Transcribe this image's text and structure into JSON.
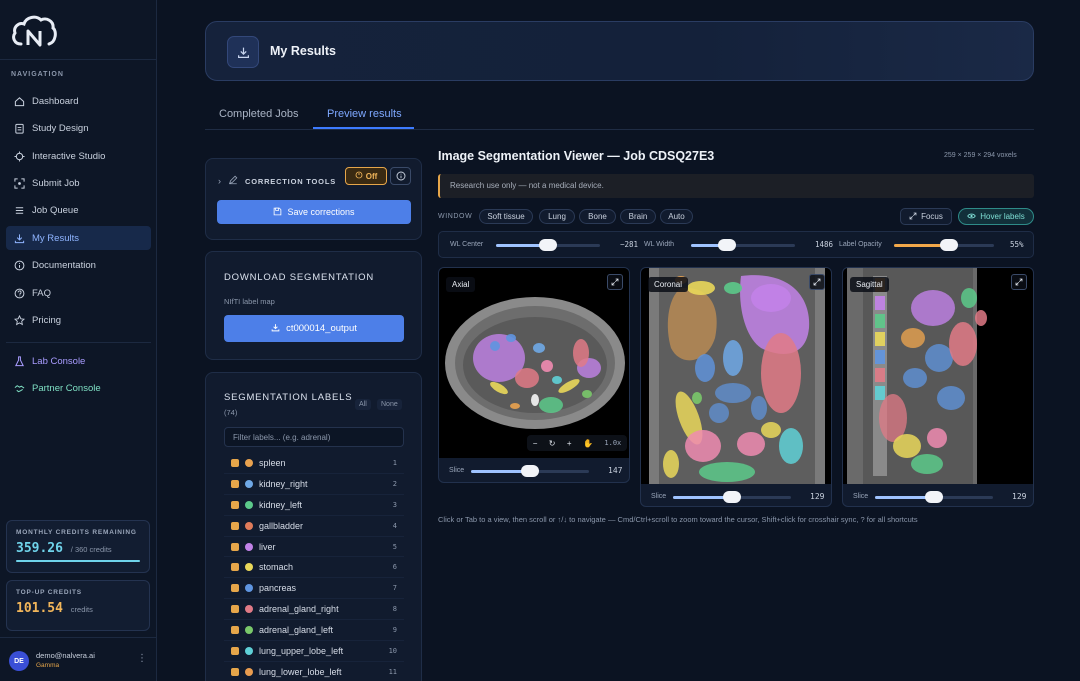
{
  "sidebar": {
    "nav_heading": "NAVIGATION",
    "items": [
      {
        "label": "Dashboard",
        "icon": "home-icon"
      },
      {
        "label": "Study Design",
        "icon": "clipboard-icon"
      },
      {
        "label": "Interactive Studio",
        "icon": "crosshair-icon"
      },
      {
        "label": "Submit Job",
        "icon": "scan-icon"
      },
      {
        "label": "Job Queue",
        "icon": "list-icon"
      },
      {
        "label": "My Results",
        "icon": "download-icon",
        "active": true
      },
      {
        "label": "Documentation",
        "icon": "info-circle-icon"
      },
      {
        "label": "FAQ",
        "icon": "question-icon"
      },
      {
        "label": "Pricing",
        "icon": "star-icon"
      }
    ],
    "consoles": [
      {
        "label": "Lab Console",
        "icon": "flask-icon"
      },
      {
        "label": "Partner Console",
        "icon": "handshake-icon"
      }
    ],
    "credits": {
      "monthly_title": "MONTHLY CREDITS REMAINING",
      "monthly_value": "359.26",
      "monthly_suffix": "/ 360 credits",
      "monthly_fraction": 0.998,
      "topup_title": "TOP-UP CREDITS",
      "topup_value": "101.54",
      "topup_suffix": "credits"
    },
    "user": {
      "initials": "DE",
      "email": "demo@nalvera.ai",
      "plan": "Gamma"
    }
  },
  "header": {
    "title": "My Results"
  },
  "tabs": [
    {
      "label": "Completed Jobs",
      "active": false
    },
    {
      "label": "Preview results",
      "active": true
    }
  ],
  "correction": {
    "label": "CORRECTION TOOLS",
    "toggle": "Off",
    "save": "Save corrections"
  },
  "download": {
    "title": "DOWNLOAD SEGMENTATION",
    "subtitle": "NIfTI label map",
    "button": "ct000014_output"
  },
  "labels_panel": {
    "title": "SEGMENTATION LABELS",
    "count": "(74)",
    "all": "All",
    "none": "None",
    "filter_placeholder": "Filter labels... (e.g. adrenal)",
    "items": [
      {
        "name": "spleen",
        "num": "1",
        "color": "#e9a24f"
      },
      {
        "name": "kidney_right",
        "num": "2",
        "color": "#6fa8e6"
      },
      {
        "name": "kidney_left",
        "num": "3",
        "color": "#5cc98a"
      },
      {
        "name": "gallbladder",
        "num": "4",
        "color": "#e07b5a"
      },
      {
        "name": "liver",
        "num": "5",
        "color": "#c282e8"
      },
      {
        "name": "stomach",
        "num": "6",
        "color": "#e9d75a"
      },
      {
        "name": "pancreas",
        "num": "7",
        "color": "#5f95e0"
      },
      {
        "name": "adrenal_gland_right",
        "num": "8",
        "color": "#e07a86"
      },
      {
        "name": "adrenal_gland_left",
        "num": "9",
        "color": "#7ac86a"
      },
      {
        "name": "lung_upper_lobe_left",
        "num": "10",
        "color": "#5fd0d6"
      },
      {
        "name": "lung_lower_lobe_left",
        "num": "11",
        "color": "#e99c4f"
      }
    ]
  },
  "viewer": {
    "title": "Image Segmentation Viewer — Job CDSQ27E3",
    "dims": "259 × 259 × 294 voxels",
    "warning": "Research use only — not a medical device.",
    "window_label": "WINDOW",
    "presets": [
      "Soft tissue",
      "Lung",
      "Bone",
      "Brain",
      "Auto"
    ],
    "focus": "Focus",
    "hover_labels": "Hover labels",
    "wl_center": {
      "label": "WL Center",
      "value": "−281",
      "fraction": 0.5
    },
    "wl_width": {
      "label": "WL Width",
      "value": "1486",
      "fraction": 0.35
    },
    "opacity": {
      "label": "Label Opacity",
      "value": "55%",
      "fraction": 0.55
    },
    "views": [
      {
        "name": "Axial",
        "slice_label": "Slice",
        "slice": "147",
        "fraction": 0.5
      },
      {
        "name": "Coronal",
        "slice_label": "Slice",
        "slice": "129",
        "fraction": 0.5
      },
      {
        "name": "Sagittal",
        "slice_label": "Slice",
        "slice": "129",
        "fraction": 0.5
      }
    ],
    "zoom": "1.0x",
    "help": "Click or Tab to a view, then scroll or ↑/↓ to navigate — Cmd/Ctrl+scroll to zoom toward the cursor, Shift+click for crosshair sync, ? for all shortcuts"
  },
  "colors": {
    "accent": "#4d7fe8",
    "warning": "#e6a64a",
    "teal": "#2e8b88"
  }
}
